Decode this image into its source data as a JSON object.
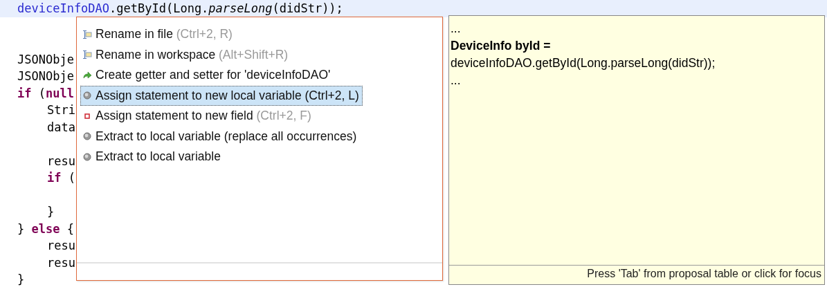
{
  "editor": {
    "lines": [
      {
        "kind": "code",
        "highlighted": true,
        "segments": [
          {
            "kind": "field",
            "text": "deviceInfoDAO"
          },
          {
            "kind": "plain",
            "text": ".getById(Long."
          },
          {
            "kind": "static",
            "text": "parseLong"
          },
          {
            "kind": "plain",
            "text": "(didStr));"
          }
        ]
      },
      {
        "kind": "blank"
      },
      {
        "kind": "blank"
      },
      {
        "kind": "code",
        "highlighted": false,
        "segments": [
          {
            "kind": "plain",
            "text": "JSONObje"
          }
        ]
      },
      {
        "kind": "code",
        "highlighted": false,
        "segments": [
          {
            "kind": "plain",
            "text": "JSONObje"
          }
        ]
      },
      {
        "kind": "code",
        "highlighted": false,
        "segments": [
          {
            "kind": "keyword",
            "text": "if"
          },
          {
            "kind": "plain",
            "text": " ("
          },
          {
            "kind": "keyword",
            "text": "null"
          }
        ],
        "children": [
          {
            "kind": "code",
            "highlighted": false,
            "segments": [
              {
                "kind": "plain",
                "text": "Stri"
              }
            ]
          },
          {
            "kind": "code",
            "highlighted": false,
            "segments": [
              {
                "kind": "plain",
                "text": "data"
              }
            ]
          },
          {
            "kind": "blank"
          },
          {
            "kind": "code",
            "highlighted": false,
            "segments": [
              {
                "kind": "plain",
                "text": "resu"
              }
            ]
          },
          {
            "kind": "code",
            "highlighted": false,
            "segments": [
              {
                "kind": "keyword",
                "text": "if"
              },
              {
                "kind": "plain",
                "text": " ("
              }
            ]
          },
          {
            "kind": "blank"
          },
          {
            "kind": "code",
            "highlighted": false,
            "segments": [
              {
                "kind": "plain",
                "text": "}"
              }
            ]
          }
        ]
      },
      {
        "kind": "code",
        "highlighted": false,
        "segments": [
          {
            "kind": "plain",
            "text": "} "
          },
          {
            "kind": "keyword",
            "text": "else"
          },
          {
            "kind": "plain",
            "text": " {"
          }
        ],
        "children": [
          {
            "kind": "code",
            "highlighted": false,
            "segments": [
              {
                "kind": "plain",
                "text": "resu"
              }
            ]
          },
          {
            "kind": "code",
            "highlighted": false,
            "segments": [
              {
                "kind": "plain",
                "text": "resu"
              }
            ]
          }
        ]
      },
      {
        "kind": "code",
        "highlighted": false,
        "segments": [
          {
            "kind": "plain",
            "text": "}"
          }
        ]
      }
    ]
  },
  "quick_assist": {
    "items": [
      {
        "kind": "rename",
        "label": "Rename in file",
        "shortcut": "(Ctrl+2, R)",
        "selected": false
      },
      {
        "kind": "rename",
        "label": "Rename in workspace",
        "shortcut": "(Alt+Shift+R)",
        "selected": false
      },
      {
        "kind": "getter",
        "label": "Create getter and setter for 'deviceInfoDAO'",
        "selected": false
      },
      {
        "kind": "local",
        "label": "Assign statement to new local variable (Ctrl+2, L)",
        "selected": true
      },
      {
        "kind": "field",
        "label": "Assign statement to new field",
        "shortcut": "(Ctrl+2, F)",
        "selected": false
      },
      {
        "kind": "local",
        "label": "Extract to local variable (replace all occurrences)",
        "selected": false
      },
      {
        "kind": "local",
        "label": "Extract to local variable",
        "selected": false
      }
    ]
  },
  "preview": {
    "lines": [
      {
        "kind": "plain",
        "text": "..."
      },
      {
        "kind": "bold",
        "text": "DeviceInfo byId ="
      },
      {
        "kind": "plain",
        "text": "deviceInfoDAO.getById(Long.parseLong(didStr));"
      },
      {
        "kind": "plain",
        "text": "..."
      }
    ],
    "footer": "Press 'Tab' from proposal table or click for focus"
  }
}
